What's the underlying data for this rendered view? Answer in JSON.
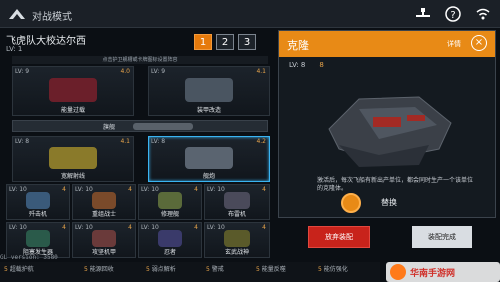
{
  "header": {
    "mode_title": "对战模式"
  },
  "loadout": {
    "commander_name": "飞虎队大校达尔西",
    "commander_level": "LV: 1",
    "presets": [
      "1",
      "2",
      "3"
    ],
    "active_preset": "1",
    "hint": "点击护卫舰槽或卡牌图标设置阵容",
    "flagship_label": "旗舰",
    "slots": [
      {
        "level": "LV: 9",
        "stars": "4.0",
        "name": "能量过载"
      },
      {
        "level": "LV: 9",
        "stars": "4.1",
        "name": "装甲改造"
      },
      {
        "level": "LV: 8",
        "stars": "4.1",
        "name": "宽解射线"
      },
      {
        "level": "LV: 8",
        "stars": "4.2",
        "name": "舰炮"
      }
    ],
    "cards_row1": [
      {
        "level": "LV: 10",
        "stars": "4",
        "name": "歼击机"
      },
      {
        "level": "LV: 10",
        "stars": "4",
        "name": "重组战士"
      },
      {
        "level": "LV: 10",
        "stars": "4",
        "name": "修理舰"
      },
      {
        "level": "LV: 10",
        "stars": "4",
        "name": "布雷机"
      }
    ],
    "cards_row2": [
      {
        "level": "LV: 10",
        "stars": "4",
        "name": "阻塞发生器"
      },
      {
        "level": "LV: 10",
        "stars": "4",
        "name": "攻坚机甲"
      },
      {
        "level": "LV: 10",
        "stars": "4",
        "name": "忍者"
      },
      {
        "level": "LV: 10",
        "stars": "4",
        "name": "玄武战神"
      }
    ]
  },
  "bottom": {
    "debug": "GL version: 3580",
    "items": [
      {
        "count": "5",
        "label": "超载护航"
      },
      {
        "count": "5",
        "label": "能源回收"
      },
      {
        "count": "5",
        "label": "弱点解析"
      },
      {
        "count": "5",
        "label": "警戒"
      },
      {
        "count": "5",
        "label": "能量反噬"
      },
      {
        "count": "5",
        "label": "能仿强化"
      }
    ]
  },
  "detail": {
    "title": "克隆",
    "details_link": "详情",
    "level": "LV: 8",
    "stars": "8",
    "description": "激活后，每次飞船有新出产单位，都会同时生产一个该单位的克隆体。",
    "swap_label": "替换"
  },
  "actions": {
    "abandon": "放弃装配",
    "done": "装配完成"
  },
  "watermark": {
    "text": "华南手游网"
  },
  "colors": {
    "accent": "#e88a16",
    "danger": "#c8231b",
    "selection": "#3ab4f2"
  }
}
